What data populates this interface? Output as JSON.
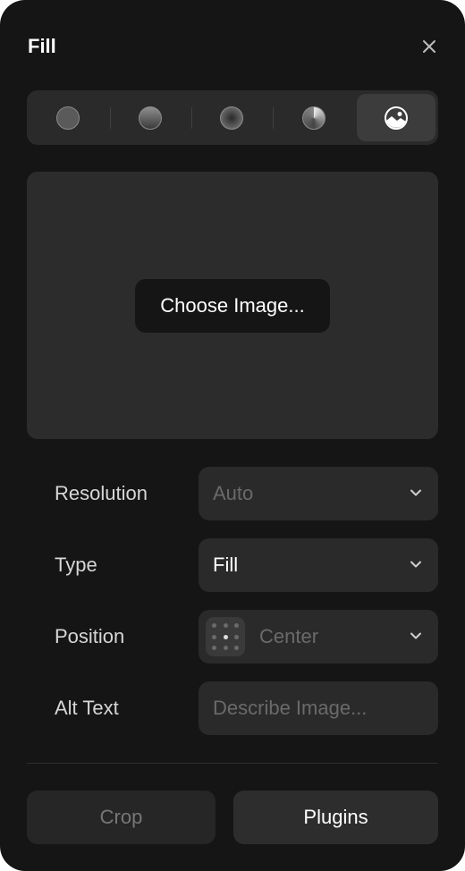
{
  "header": {
    "title": "Fill",
    "close_icon": "close-icon"
  },
  "fill_tabs": [
    {
      "name": "solid",
      "icon": "solid-fill-icon",
      "active": false
    },
    {
      "name": "linear",
      "icon": "linear-gradient-icon",
      "active": false
    },
    {
      "name": "radial",
      "icon": "radial-gradient-icon",
      "active": false
    },
    {
      "name": "conic",
      "icon": "conic-gradient-icon",
      "active": false
    },
    {
      "name": "image",
      "icon": "image-fill-icon",
      "active": true
    }
  ],
  "preview": {
    "choose_label": "Choose Image..."
  },
  "fields": {
    "resolution": {
      "label": "Resolution",
      "value": "Auto"
    },
    "type": {
      "label": "Type",
      "value": "Fill"
    },
    "position": {
      "label": "Position",
      "value": "Center"
    },
    "alt_text": {
      "label": "Alt Text",
      "placeholder": "Describe Image..."
    }
  },
  "footer": {
    "crop_label": "Crop",
    "plugins_label": "Plugins"
  },
  "colors": {
    "panel_bg": "#151515",
    "control_bg": "#2a2a2a",
    "text_primary": "#ffffff",
    "text_muted": "#6a6a6a"
  }
}
